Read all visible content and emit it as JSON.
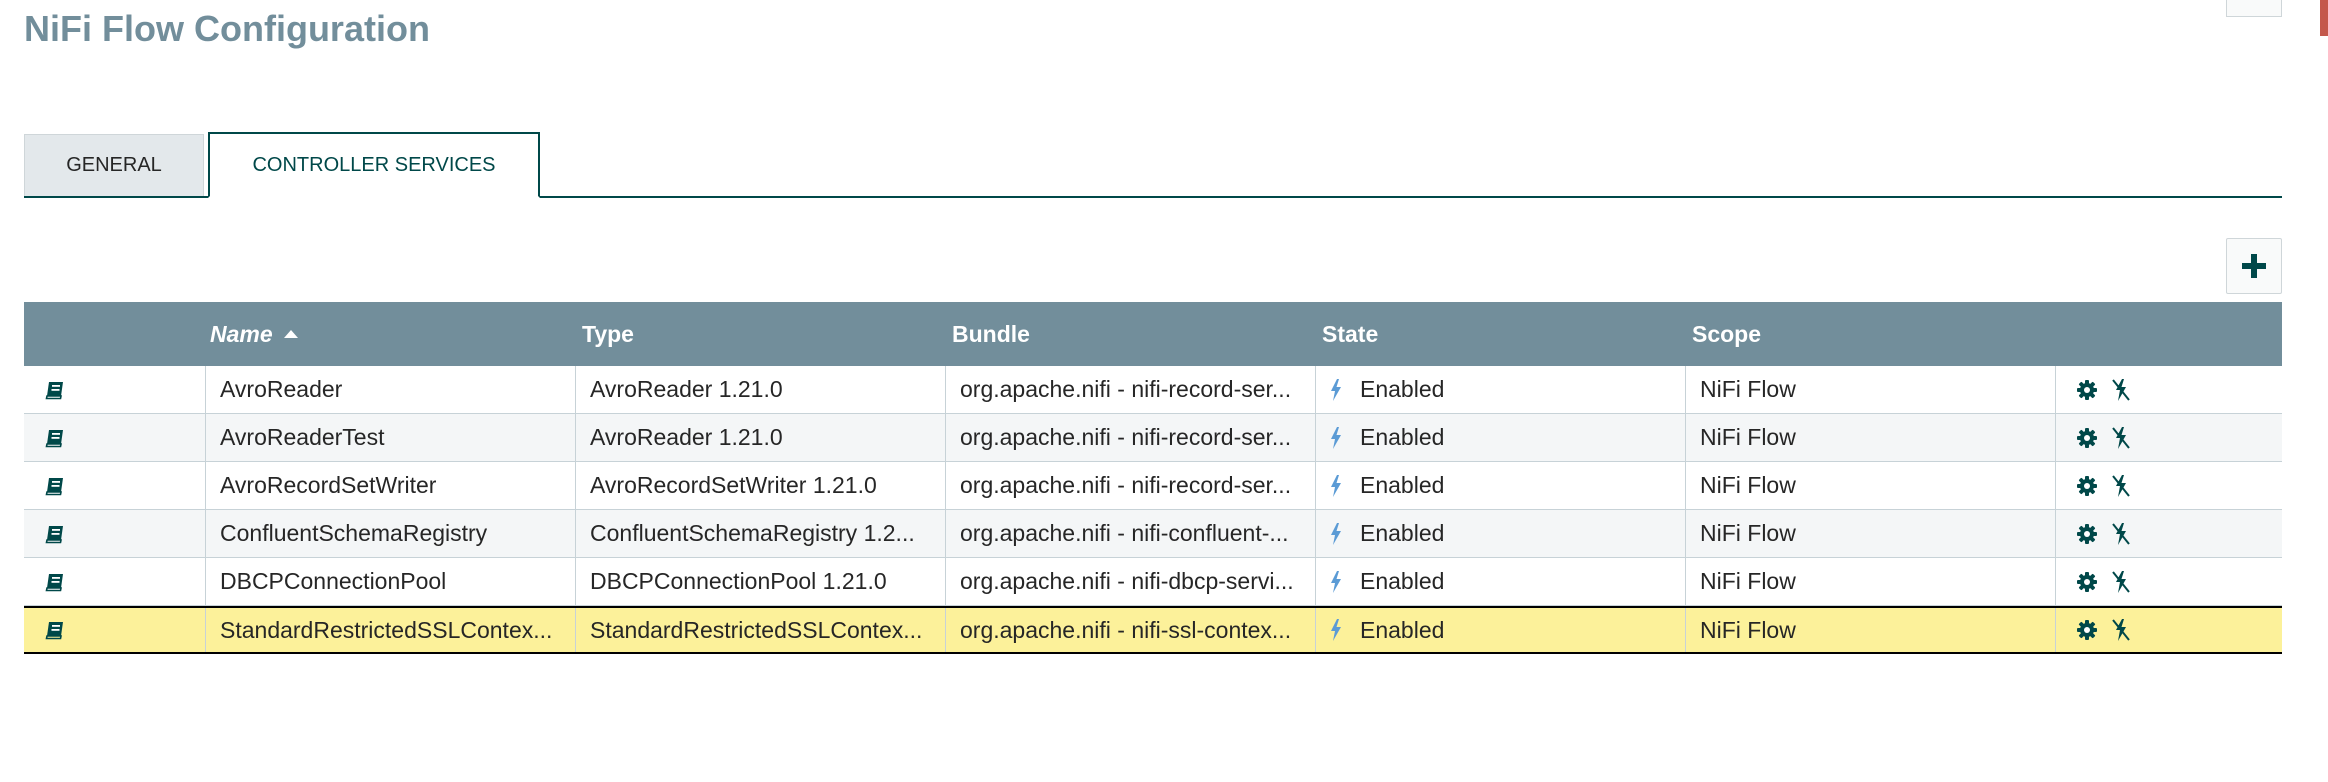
{
  "header": {
    "title": "NiFi Flow Configuration"
  },
  "tabs": [
    {
      "label": "GENERAL",
      "active": false
    },
    {
      "label": "CONTROLLER SERVICES",
      "active": true
    }
  ],
  "toolbar": {
    "add_icon": "plus-icon"
  },
  "table": {
    "columns": {
      "name": "Name",
      "type": "Type",
      "bundle": "Bundle",
      "state": "State",
      "scope": "Scope"
    },
    "sort": {
      "column": "Name",
      "direction": "ascending"
    },
    "rows": [
      {
        "name": "AvroReader",
        "type": "AvroReader 1.21.0",
        "bundle": "org.apache.nifi - nifi-record-ser...",
        "state": "Enabled",
        "scope": "NiFi Flow"
      },
      {
        "name": "AvroReaderTest",
        "type": "AvroReader 1.21.0",
        "bundle": "org.apache.nifi - nifi-record-ser...",
        "state": "Enabled",
        "scope": "NiFi Flow"
      },
      {
        "name": "AvroRecordSetWriter",
        "type": "AvroRecordSetWriter 1.21.0",
        "bundle": "org.apache.nifi - nifi-record-ser...",
        "state": "Enabled",
        "scope": "NiFi Flow"
      },
      {
        "name": "ConfluentSchemaRegistry",
        "type": "ConfluentSchemaRegistry 1.2...",
        "bundle": "org.apache.nifi - nifi-confluent-...",
        "state": "Enabled",
        "scope": "NiFi Flow"
      },
      {
        "name": "DBCPConnectionPool",
        "type": "DBCPConnectionPool 1.21.0",
        "bundle": "org.apache.nifi - nifi-dbcp-servi...",
        "state": "Enabled",
        "scope": "NiFi Flow"
      },
      {
        "name": "StandardRestrictedSSLContex...",
        "type": "StandardRestrictedSSLContex...",
        "bundle": "org.apache.nifi - nifi-ssl-contex...",
        "state": "Enabled",
        "scope": "NiFi Flow",
        "selected": true
      }
    ]
  },
  "colors": {
    "header_bg": "#728e9b",
    "accent": "#004849",
    "selected_row": "#fcf19a",
    "state_icon": "#5b9bd5"
  }
}
